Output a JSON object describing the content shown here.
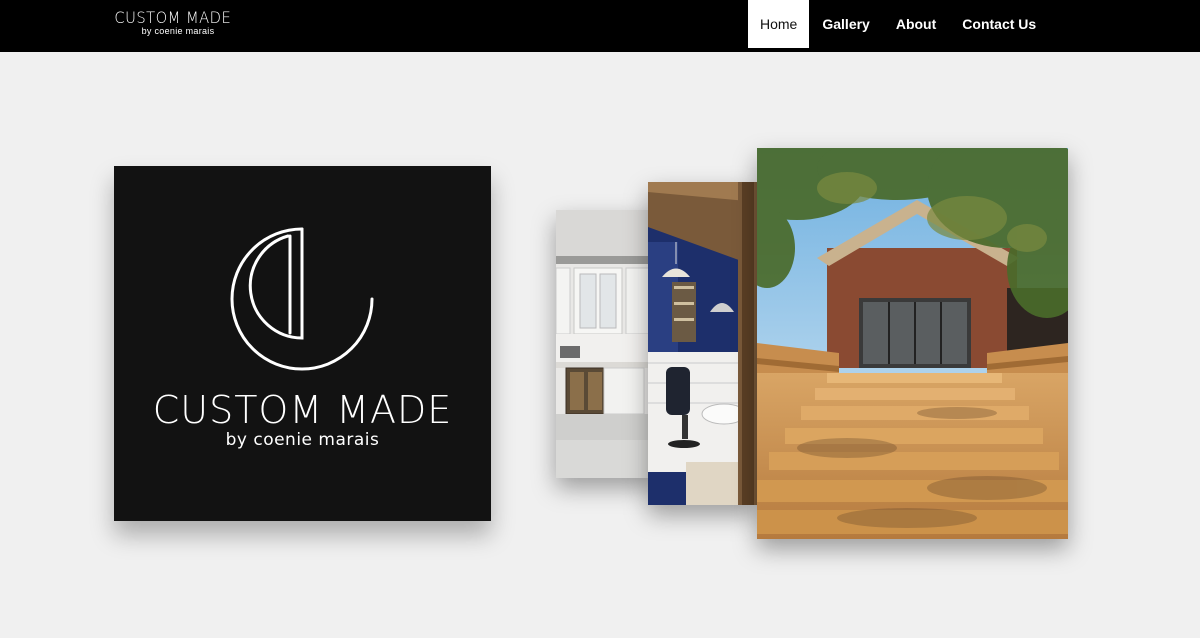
{
  "header": {
    "brand_title": "CUSTOM MADE",
    "brand_subtitle": "by coenie marais"
  },
  "nav": {
    "items": [
      "Home",
      "Gallery",
      "About",
      "Contact Us"
    ],
    "active": "Home"
  },
  "hero": {
    "logo_title": "CUSTOM MADE",
    "logo_subtitle": "by coenie marais"
  },
  "gallery": {
    "images": [
      {
        "name": "kitchen-photo",
        "depicts": "white kitchen with wine fridge"
      },
      {
        "name": "salon-photo",
        "depicts": "salon with blue walls and barber chair"
      },
      {
        "name": "deck-photo",
        "depicts": "wooden deck steps leading to brick building under trees"
      }
    ]
  },
  "colors": {
    "header_bg": "#000000",
    "page_bg": "#f0f0f0",
    "logo_card_bg": "#121212",
    "active_nav_bg": "#ffffff"
  }
}
